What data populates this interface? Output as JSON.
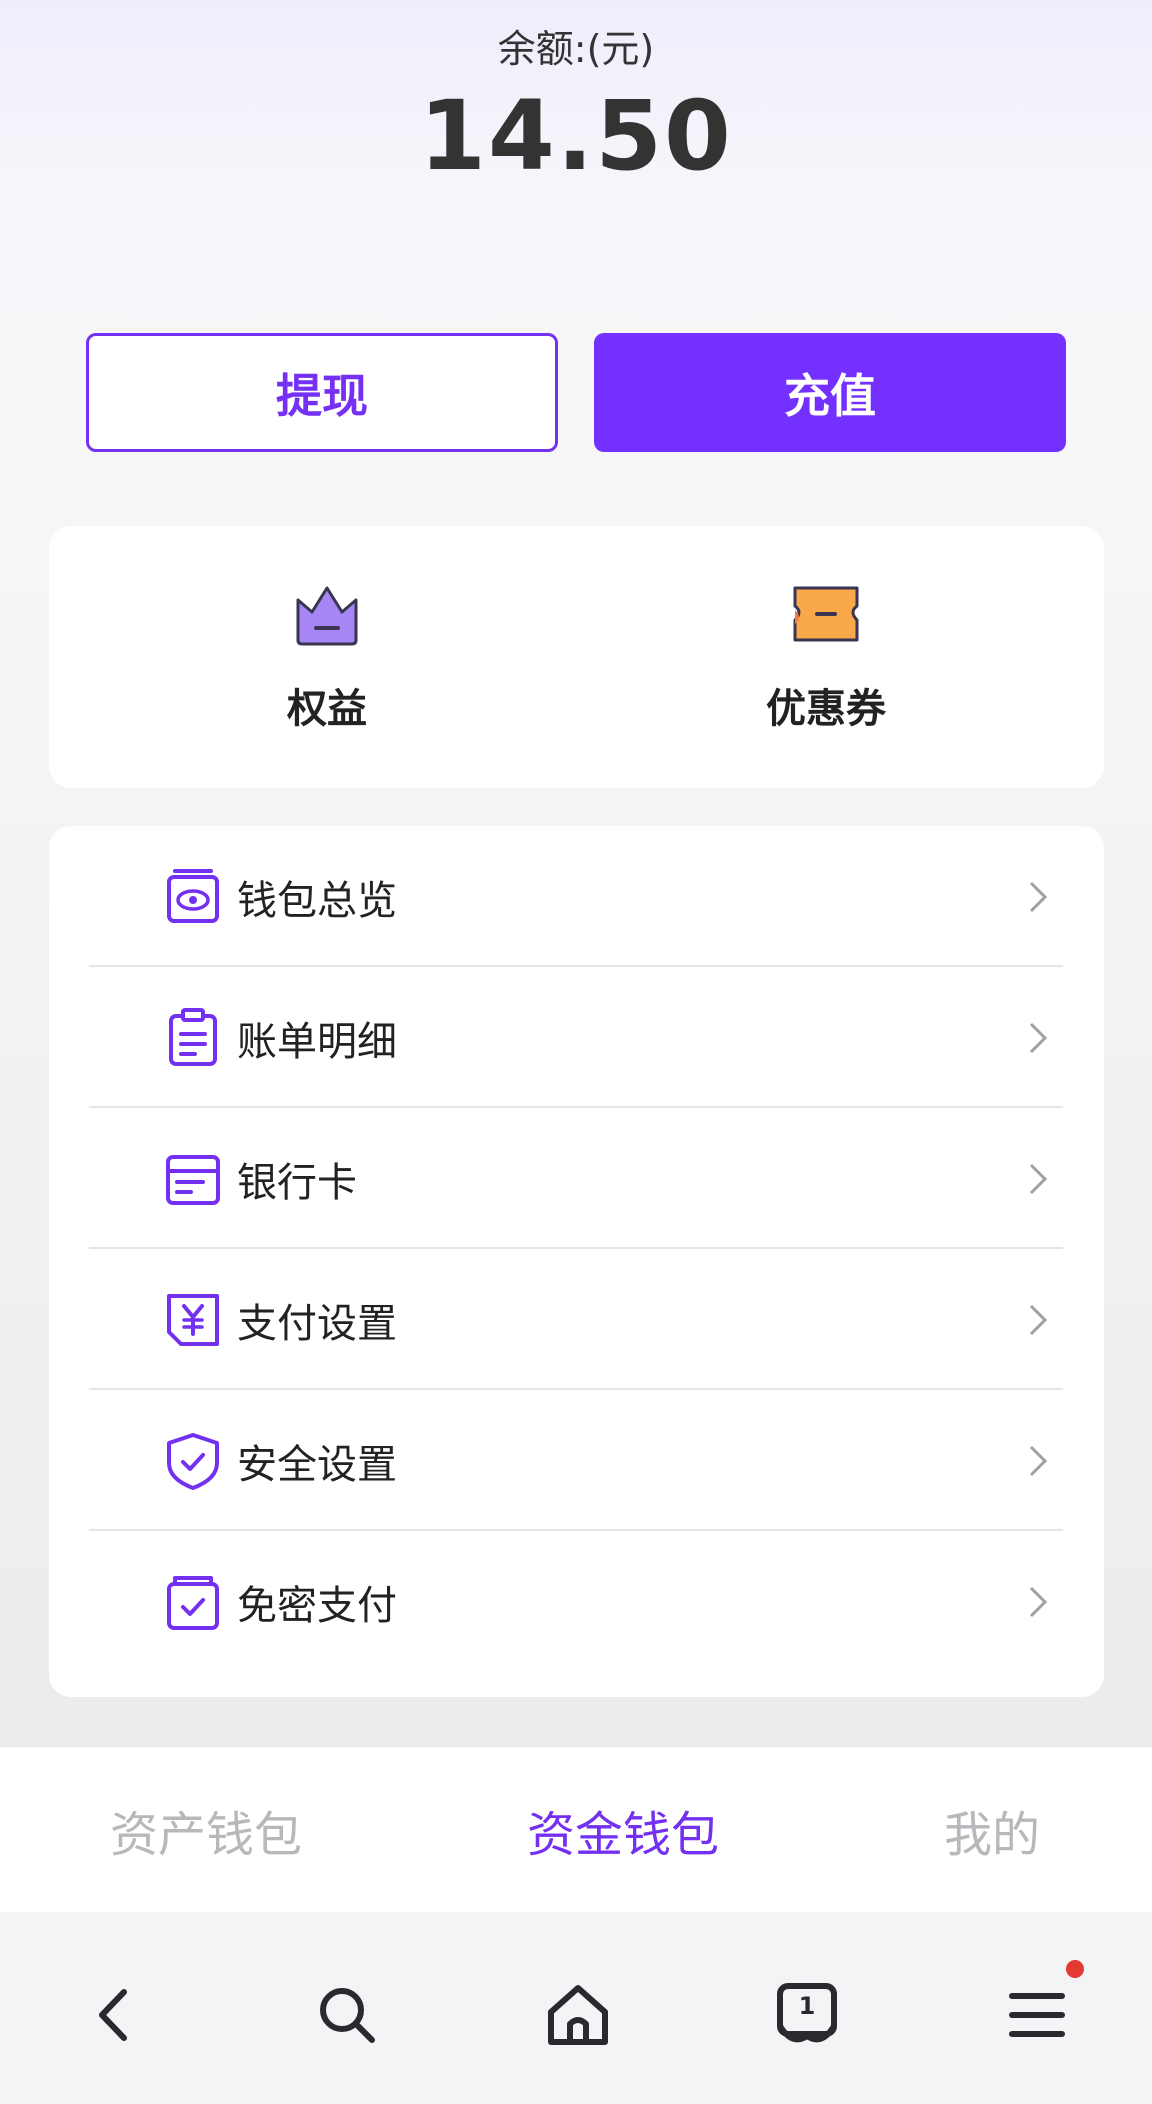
{
  "balance": {
    "label": "余额:(元)",
    "amount": "14.50"
  },
  "actions": {
    "withdraw": "提现",
    "recharge": "充值"
  },
  "quick_links": [
    {
      "label": "权益",
      "icon": "crown-icon"
    },
    {
      "label": "优惠券",
      "icon": "coupon-icon"
    }
  ],
  "menu": [
    {
      "label": "钱包总览",
      "icon": "wallet-eye-icon"
    },
    {
      "label": "账单明细",
      "icon": "bill-clipboard-icon"
    },
    {
      "label": "银行卡",
      "icon": "bank-card-icon"
    },
    {
      "label": "支付设置",
      "icon": "yuan-payment-icon"
    },
    {
      "label": "安全设置",
      "icon": "shield-check-icon"
    },
    {
      "label": "免密支付",
      "icon": "wallet-check-icon"
    }
  ],
  "tabs": {
    "assets": "资产钱包",
    "funds": "资金钱包",
    "mine": "我的",
    "active": "资金钱包"
  },
  "browser_nav": {
    "tab_count": "1"
  },
  "colors": {
    "accent": "#7330fe",
    "text": "#222222",
    "inactive_tab": "#b8b8bc"
  }
}
